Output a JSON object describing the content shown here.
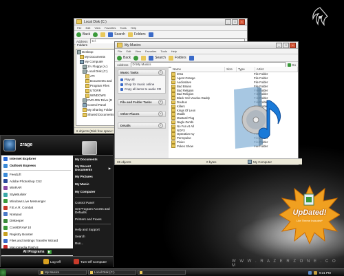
{
  "desktop": {
    "watermark": "W W W . R A Z E R Z O N E . C O M"
  },
  "badge": {
    "title": "UpDated!",
    "subtitle": "Lite Theme Included*"
  },
  "disk_window": {
    "title": "Local Disk (C:)",
    "menu": [
      "File",
      "Edit",
      "View",
      "Favorites",
      "Tools",
      "Help"
    ],
    "toolbar": {
      "back": "Back",
      "search": "Search",
      "folders": "Folders"
    },
    "address_label": "Address",
    "address_value": "C:\\",
    "tree_header": "Folders",
    "tree": [
      "Desktop",
      "My Documents",
      "My Computer",
      "3½ Floppy (A:)",
      "Local Disk (C:)",
      "ATI",
      "Documents and",
      "Program Files",
      "UTORR",
      "WINDOWS",
      "DVD-RW Drive (D",
      "Control Panel",
      "My Sharing Folder",
      "Shared Documents"
    ],
    "status": "6 objects (Disk free space: 23"
  },
  "music_window": {
    "title": "My Musics",
    "menu": [
      "File",
      "Edit",
      "View",
      "Favorites",
      "Tools",
      "Help"
    ],
    "toolbar": {
      "back": "Back",
      "search": "Search",
      "folders": "Folders"
    },
    "address_label": "Address",
    "address_value": "D:\\My Musics",
    "go_label": "Go",
    "task_groups": [
      {
        "title": "Music Tasks",
        "links": [
          "Play all",
          "Shop for music online",
          "Copy all items to audio CD"
        ]
      },
      {
        "title": "File and Folder Tasks",
        "links": []
      },
      {
        "title": "Other Places",
        "links": []
      },
      {
        "title": "Details",
        "links": []
      }
    ],
    "columns": [
      "Name",
      "Size",
      "Type",
      "Artist"
    ],
    "files": [
      "2011",
      "Agent Orange",
      "Audioslave",
      "Bad Brains",
      "Bad Religion",
      "Bad Religion",
      "Black Veil Voodoo Daddy",
      "Doubus",
      "Killers",
      "Kings Of Leon",
      "Mudib",
      "Mustard Plug",
      "Naglu Zumbi",
      "No Fun At All",
      "NOFX",
      "Operation Ivy",
      "Pennywise",
      "Pixies",
      "Pokes Show"
    ],
    "file_type": "File Folder",
    "status_left": "26 objects",
    "status_mid": "0 bytes",
    "status_right": "My Computer"
  },
  "start_menu": {
    "user": "zrage",
    "pinned": [
      "Internet Explorer",
      "Outlook Express"
    ],
    "recent": [
      "FeedLift",
      "Adobe Photoshop CS2",
      "WinRAR",
      "StyleBuilder",
      "Windows Live Messenger",
      "F.E.A.R. Combat",
      "Notepad",
      "Diskeeper",
      "CorelDRAW 10",
      "Registry Booster",
      "Files and Settings Transfer Wizard",
      "Macromedia Flash 8"
    ],
    "all_programs": "All Programs",
    "right_top": [
      "My Documents",
      "My Recent Documents",
      "My Pictures",
      "My Music",
      "My Computer"
    ],
    "right_bottom": [
      "Control Panel",
      "Set Program Access and Defaults",
      "Printers and Faxes",
      "Help and Support",
      "Search",
      "Run..."
    ],
    "log_off": "Log Off",
    "turn_off": "Turn Off Computer"
  },
  "taskbar": {
    "tasks": [
      "My Musics",
      "Local Disk (C:)",
      ""
    ],
    "clock": "9:31 PM"
  },
  "colors": {
    "badge": "#f0a020",
    "start_accent": "#3a9a3a",
    "folder": "#e8c85a"
  }
}
